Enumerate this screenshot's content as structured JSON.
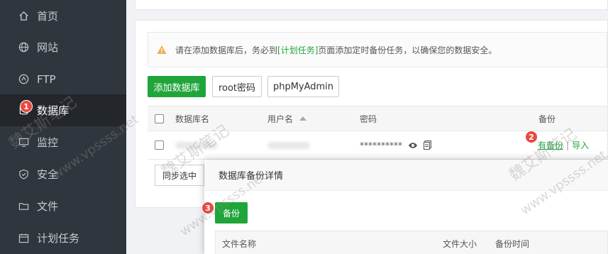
{
  "sidebar": {
    "items": [
      {
        "label": "首页",
        "icon": "home-icon"
      },
      {
        "label": "网站",
        "icon": "globe-icon"
      },
      {
        "label": "FTP",
        "icon": "ftp-icon"
      },
      {
        "label": "数据库",
        "icon": "database-icon",
        "active": true
      },
      {
        "label": "监控",
        "icon": "monitor-icon"
      },
      {
        "label": "安全",
        "icon": "shield-icon"
      },
      {
        "label": "文件",
        "icon": "folder-icon"
      },
      {
        "label": "计划任务",
        "icon": "calendar-icon"
      }
    ]
  },
  "alert": {
    "pre": "请在添加数据库后，务必到",
    "link": "[计划任务]",
    "post": "页面添加定时备份任务，以确保您的数据安全。"
  },
  "toolbar": {
    "add_db": "添加数据库",
    "root_pwd": "root密码",
    "phpmyadmin": "phpMyAdmin"
  },
  "table": {
    "headers": [
      "数据库名",
      "用户名",
      "密码",
      "备份"
    ],
    "rows": [
      {
        "password": "**********",
        "backup_view": "有备份",
        "separator": "|",
        "import": "导入"
      }
    ]
  },
  "sync_label": "同步选中",
  "modal": {
    "title": "数据库备份详情",
    "backup_btn": "备份",
    "headers": [
      "文件名称",
      "文件大小",
      "备份时间"
    ]
  },
  "badges": [
    "1",
    "2",
    "3"
  ],
  "watermarks": [
    "魏艾斯笔记",
    "www.vpssss.net"
  ],
  "colors": {
    "accent": "#20a53a",
    "sidebar": "#30363d",
    "badge": "#e9483f",
    "warning": "#f0ad4e"
  }
}
